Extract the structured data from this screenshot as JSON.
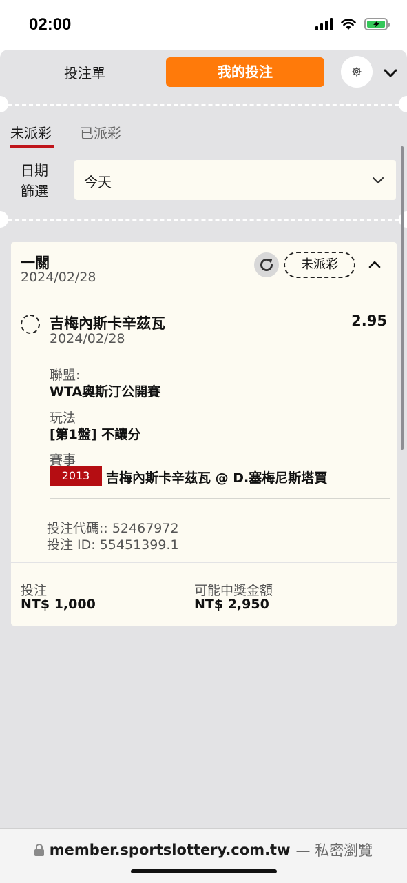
{
  "status_bar": {
    "time": "02:00"
  },
  "header": {
    "tab_betslip": "投注單",
    "tab_mybets": "我的投注"
  },
  "sub_tabs": {
    "unsettled": "未派彩",
    "settled": "已派彩"
  },
  "date_filter": {
    "label_line1": "日期",
    "label_line2": "篩選",
    "selected": "今天"
  },
  "bet": {
    "type": "一關",
    "date": "2024/02/28",
    "status": "未派彩",
    "selection": "吉梅內斯卡辛茲瓦",
    "odds": "2.95",
    "selection_date": "2024/02/28",
    "league_label": "聯盟:",
    "league_value": "WTA奧斯汀公開賽",
    "market_label": "玩法",
    "market_value": "[第1盤] 不讓分",
    "event_label": "賽事",
    "event_code": "2013",
    "event_name": "吉梅內斯卡辛茲瓦 @ D.塞梅尼斯塔賈",
    "bet_code": "投注代碼:: 52467972",
    "bet_id": "投注 ID: 55451399.1",
    "stake_label": "投注",
    "stake_value": "NT$ 1,000",
    "payout_label": "可能中獎金額",
    "payout_value": "NT$ 2,950"
  },
  "browser": {
    "domain": "member.sportslottery.com.tw",
    "mode": "— 私密瀏覽"
  },
  "colors": {
    "accent_orange": "#ff7a0a",
    "accent_red": "#c0151b",
    "badge_red": "#b50d12",
    "panel_gray": "#e3e3e5",
    "card_cream": "#fdfbf2"
  }
}
